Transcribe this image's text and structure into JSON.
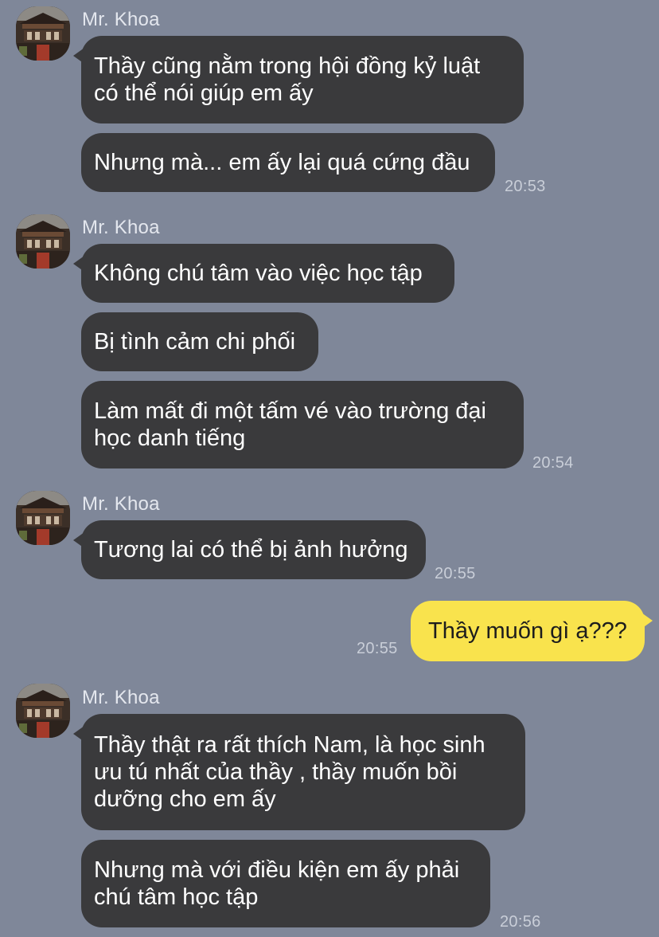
{
  "conversation": {
    "g1": {
      "sender": "Mr. Khoa",
      "messages": [
        "Thầy cũng nằm trong hội đồng kỷ luật\ncó thể nói giúp em ấy",
        "Nhưng mà... em ấy lại quá cứng đầu"
      ],
      "time": "20:53"
    },
    "g2": {
      "sender": "Mr. Khoa",
      "messages": [
        "Không chú tâm vào việc học tập",
        "Bị tình cảm chi phối",
        "Làm mất đi một tấm vé vào trường đại\nhọc danh tiếng"
      ],
      "time": "20:54"
    },
    "g3": {
      "sender": "Mr. Khoa",
      "messages": [
        "Tương lai có thể bị ảnh hưởng"
      ],
      "time": "20:55"
    },
    "out1": {
      "message": "Thầy muốn gì ạ???",
      "time": "20:55"
    },
    "g4": {
      "sender": "Mr. Khoa",
      "messages": [
        "Thầy thật ra rất thích Nam, là học sinh\nưu tú nhất của thầy , thầy muốn bồi\ndưỡng cho em ấy",
        "Nhưng mà với điều kiện em ấy phải\nchú tâm học tập"
      ],
      "time": "20:56"
    }
  },
  "colors": {
    "background": "#7f8799",
    "incoming_bubble": "#3a3a3c",
    "outgoing_bubble": "#f9e34d",
    "incoming_text": "#ffffff",
    "outgoing_text": "#1d1d1d",
    "meta_text": "#c9ced8"
  }
}
